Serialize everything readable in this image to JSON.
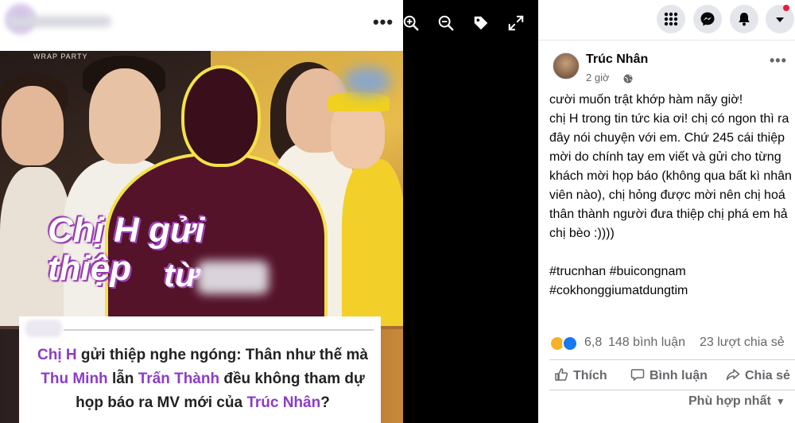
{
  "viewer": {
    "image": {
      "watermark_text": "WRAP PARTY",
      "headline_line1": "Chị H gửi thiệp",
      "headline_line2": "từ",
      "caption": {
        "part1": "Chị H",
        "part2": " gửi thiệp nghe ngóng: Thân như thế mà ",
        "part3": "Thu Minh",
        "part4": " lẫn ",
        "part5": "Trấn Thành",
        "part6": " đều không tham dự họp báo ra MV mới của ",
        "part7": "Trúc Nhân",
        "part8": "?"
      }
    },
    "controls": [
      "zoom-in",
      "zoom-out",
      "tag",
      "fullscreen"
    ]
  },
  "topbar": {
    "icons": [
      "menu-grid-icon",
      "messenger-icon",
      "bell-icon",
      "caret-down-icon"
    ],
    "accent": "#e41e3f"
  },
  "post": {
    "author": "Trúc Nhân",
    "time": "2 giờ",
    "body": "cười muốn trật khớp hàm nãy giờ!\nchị H trong tin tức kia ơi! chị có ngon thì ra đây nói chuyện với em. Chứ 245 cái thiệp mời do chính tay em viết và gửi cho từng khách mời họp báo (không qua bất kì nhân viên nào), chị hỏng được mời nên chị hoá thân thành người đưa thiệp chị phá em hả chị bèo :))))\n\n#trucnhan #buicongnam\n#cokhonggiumatdungtim",
    "stats": {
      "reactions": "6,8",
      "comments": "148 bình luận",
      "shares": "23 lượt chia sẻ"
    },
    "actions": {
      "like": "Thích",
      "comment": "Bình luận",
      "share": "Chia sẻ"
    },
    "sort_label": "Phù hợp nhất"
  },
  "colors": {
    "facebook_blue": "#1877f2",
    "highlight_purple": "#8b3cc8",
    "frame_yellow": "#f3e24a"
  }
}
